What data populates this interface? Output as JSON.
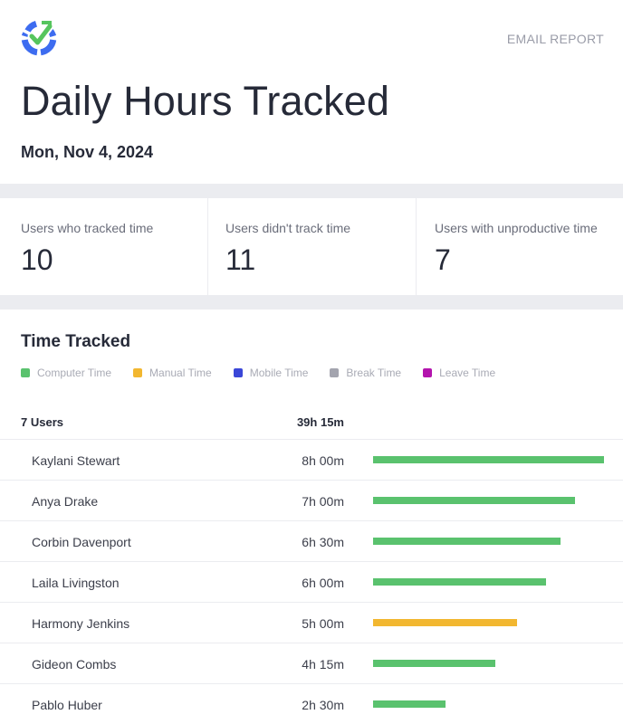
{
  "header": {
    "logo_icon": "checkmark-target-logo",
    "email_report_label": "EMAIL REPORT",
    "title": "Daily Hours Tracked",
    "date": "Mon, Nov 4, 2024"
  },
  "stats": [
    {
      "label": "Users who tracked time",
      "value": "10"
    },
    {
      "label": "Users didn't track time",
      "value": "11"
    },
    {
      "label": "Users with unproductive time",
      "value": "7"
    }
  ],
  "time_tracked": {
    "title": "Time Tracked",
    "legend": [
      {
        "label": "Computer Time",
        "color": "#5ac26e"
      },
      {
        "label": "Manual Time",
        "color": "#f2b730"
      },
      {
        "label": "Mobile Time",
        "color": "#3a47d8"
      },
      {
        "label": "Break Time",
        "color": "#a3a4ae"
      },
      {
        "label": "Leave Time",
        "color": "#b314ad"
      }
    ],
    "header": {
      "users": "7 Users",
      "total": "39h 15m"
    },
    "max_hours": 8,
    "rows": [
      {
        "name": "Kaylani Stewart",
        "time": "8h 00m",
        "hours": 8.0,
        "type": "Computer Time",
        "color": "#5ac26e"
      },
      {
        "name": "Anya Drake",
        "time": "7h 00m",
        "hours": 7.0,
        "type": "Computer Time",
        "color": "#5ac26e"
      },
      {
        "name": "Corbin Davenport",
        "time": "6h 30m",
        "hours": 6.5,
        "type": "Computer Time",
        "color": "#5ac26e"
      },
      {
        "name": "Laila Livingston",
        "time": "6h 00m",
        "hours": 6.0,
        "type": "Computer Time",
        "color": "#5ac26e"
      },
      {
        "name": "Harmony Jenkins",
        "time": "5h 00m",
        "hours": 5.0,
        "type": "Manual Time",
        "color": "#f2b730"
      },
      {
        "name": "Gideon Combs",
        "time": "4h 15m",
        "hours": 4.25,
        "type": "Computer Time",
        "color": "#5ac26e"
      },
      {
        "name": "Pablo Huber",
        "time": "2h 30m",
        "hours": 2.5,
        "type": "Computer Time",
        "color": "#5ac26e"
      }
    ]
  }
}
